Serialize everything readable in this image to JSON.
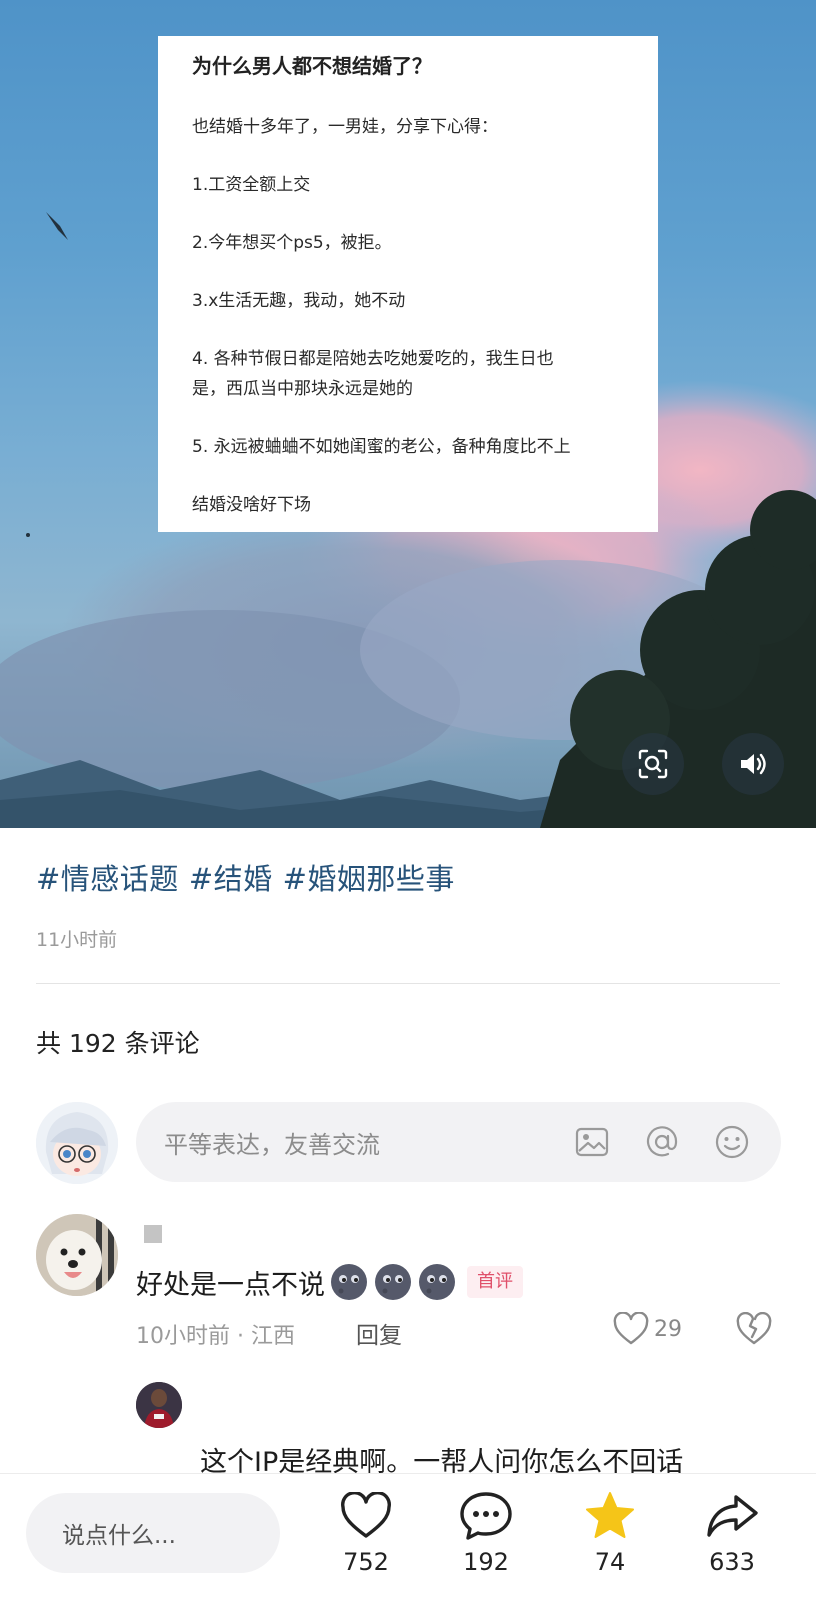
{
  "post_image": {
    "card_title": "为什么男人都不想结婚了？",
    "card_lines": [
      "也结婚十多年了，一男娃，分享下心得：",
      "1.工资全额上交",
      "2.今年想买个ps5，被拒。",
      "3.x生活无趣，我动，她不动",
      "4. 各种节假日都是陪她去吃她爱吃的，我生日也",
      "是，西瓜当中那块永远是她的",
      "5. 永远被蛐蛐不如她闺蜜的老公，备种角度比不上",
      "结婚没啥好下场"
    ]
  },
  "post": {
    "tags": [
      "#情感话题",
      "#结婚",
      "#婚姻那些事"
    ],
    "time_ago": "11小时前"
  },
  "comments_section": {
    "count_label": "共 192 条评论",
    "input_placeholder": "平等表达，友善交流"
  },
  "comment": {
    "text": "好处是一点不说",
    "badge": "首评",
    "meta": "10小时前 · 江西",
    "reply_label": "回复",
    "likes": "29"
  },
  "reply": {
    "text": "这个IP是经典啊。一帮人问你怎么不回话"
  },
  "bottom_bar": {
    "input_placeholder": "说点什么...",
    "like_count": "752",
    "comment_count": "192",
    "favorite_count": "74",
    "share_count": "633"
  },
  "colors": {
    "tag": "#27537a",
    "badge_text": "#e0506a",
    "star": "#f5c518"
  },
  "icons": [
    "scan-icon",
    "speaker-icon",
    "image-icon",
    "at-icon",
    "emoji-icon",
    "heart-icon",
    "broken-heart-icon",
    "comment-bubble-icon",
    "star-icon",
    "share-icon"
  ]
}
